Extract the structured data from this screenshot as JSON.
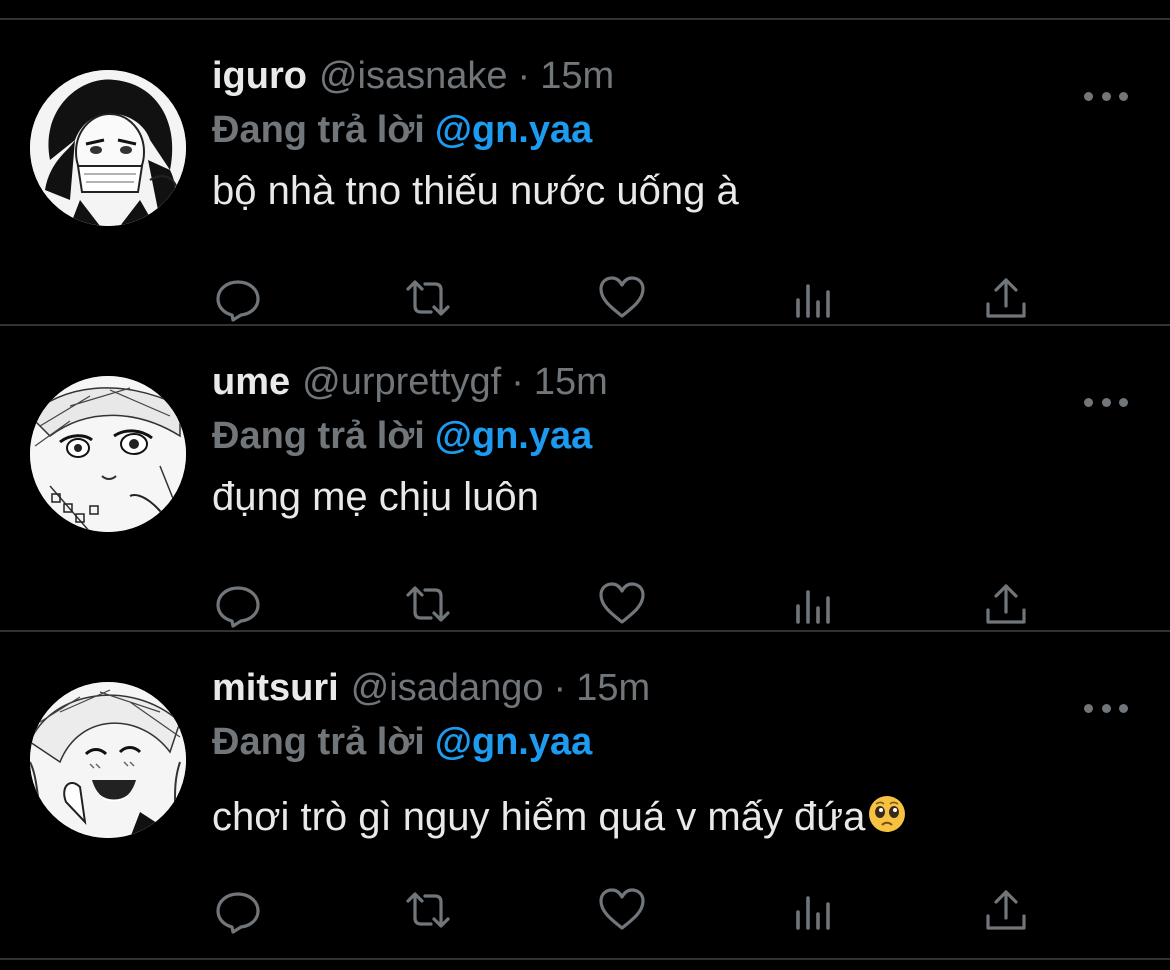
{
  "tweets": [
    {
      "display_name": "iguro",
      "handle": "@isasnake",
      "separator": "·",
      "time": "15m",
      "reply_prefix": "Đang trả lời",
      "reply_to": "@gn.yaa",
      "text": "bộ nhà tno thiếu nước uống à"
    },
    {
      "display_name": "ume",
      "handle": "@urprettygf",
      "separator": "·",
      "time": "15m",
      "reply_prefix": "Đang trả lời",
      "reply_to": "@gn.yaa",
      "text": "đụng mẹ chịu luôn"
    },
    {
      "display_name": "mitsuri",
      "handle": "@isadango",
      "separator": "·",
      "time": "15m",
      "reply_prefix": "Đang trả lời",
      "reply_to": "@gn.yaa",
      "text": "chơi trò gì nguy hiểm quá v mấy đứa",
      "emoji": "pleading-face-emoji"
    }
  ],
  "actions": [
    "reply-icon",
    "retweet-icon",
    "like-icon",
    "views-icon",
    "share-icon"
  ],
  "colors": {
    "background": "#000000",
    "text": "#e7e9ea",
    "muted": "#71767b",
    "accent": "#1d9bf0",
    "divider": "#2f3336"
  }
}
